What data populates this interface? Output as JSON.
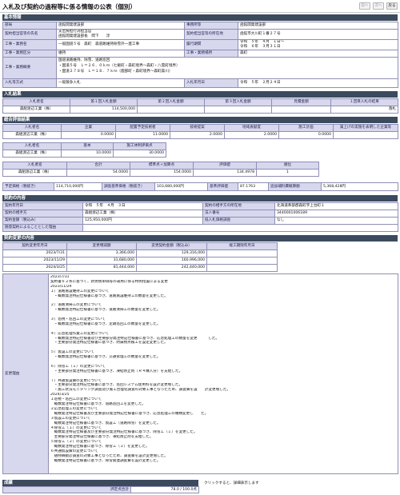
{
  "header": {
    "title": "入札及び契約の過程等に係る情報の公表（個別）",
    "nav": [
      "前へ",
      "次へ",
      "戻る"
    ]
  },
  "sections": {
    "basic": "基本情報",
    "bid": "入札結果",
    "eval": "総合評価結果",
    "contract": "契約の内容",
    "changes": "契約変更の内容",
    "grade": "成績"
  },
  "basic": {
    "rows": [
      [
        "部局",
        "函館開発建設部",
        "事務所等",
        "函館開発建設部"
      ],
      [
        "契約担当官等の氏名",
        "支出負担行為担当官\n函館開発建設部長　岡下　　淳",
        "契約担当官等の所在地",
        "函館市大川町１番２７号"
      ],
      [
        "工事・業務名",
        "一般国道５号　森町　森道路維持除雪外一連工事",
        "履行期間",
        "令和　５年　４月　１日～\n令和　６年　３月３１日"
      ],
      [
        "工事・業務区分",
        "維持",
        "工事・業務場所",
        "森町"
      ],
      [
        "工事・業務概要",
        "国道道路維持、除雪、道路巡回\n・国道５号　Ｌ＝２６．０ｋｍ（七飯町・森町境界～森町・八雲町境界）\n・国道２７８号　Ｌ＝１８．７ｋｍ（鹿部町・森町境界～森町森川）",
        "",
        ""
      ],
      [
        "入札等方式",
        "一般競争入札",
        "入札年月日",
        "令和　５年　２月２４日"
      ]
    ]
  },
  "bid": {
    "headers": [
      "入札者名",
      "第１回入札金額",
      "第２回入札金額",
      "第３回入札金額",
      "見積金額",
      "１回目入札の結果"
    ],
    "row": [
      "森組渡辺工業（株）",
      "114,500,000",
      "",
      "",
      "",
      "落札"
    ]
  },
  "eval": {
    "t1_headers": [
      "入札者名",
      "企業",
      "配置予定技術者",
      "技術提案",
      "地域貢献度",
      "施工計画",
      "賃上げの実施を表明した企業等"
    ],
    "t1_row": [
      "森組渡辺工業（株）",
      "0.0000",
      "11.0000",
      "2.0000",
      "2.0000",
      "0.0000",
      ""
    ],
    "t2_headers": [
      "入札者名",
      "基本",
      "施工体制評価点"
    ],
    "t2_row": [
      "森組渡辺工業（株）",
      "10.0000",
      "30.0000"
    ],
    "t3_headers": [
      "入札者名",
      "合計",
      "標準点＋加算点",
      "評価値",
      "順位"
    ],
    "t3_row": [
      "森組渡辺工業（株）",
      "54.0000",
      "154.0000",
      "134.4978",
      "1"
    ],
    "t4": [
      [
        "予定価格（税抜き）",
        "114,710,000円"
      ],
      [
        "調査基準価格（税抜き）",
        "103,680,000円"
      ],
      [
        "基準評価値",
        "87.1763"
      ],
      [
        "追加補料費概算額",
        "5,368,428円"
      ]
    ]
  },
  "contract": {
    "rows": [
      [
        "契約年月日",
        "令和　５年　４月　３日",
        "契約の相手方の所在地",
        "北海道茅部郡森町字上台町１"
      ],
      [
        "契約の相手方",
        "森組渡辺工業（株）",
        "法人番号",
        "3440001006189"
      ],
      [
        "契約金額（税込み）",
        "125,950,000円",
        "低入札価格調査",
        "なし"
      ],
      [
        "随意契約によることとした理由",
        "",
        "",
        ""
      ]
    ]
  },
  "changes": {
    "headers": [
      "契約変更年月日",
      "変更増減額",
      "変更契約金額（税込み）",
      "竣工期限年月日"
    ],
    "rows": [
      [
        "2023/7/31",
        "3,366,000",
        "129,316,000",
        ""
      ],
      [
        "2023/11/29",
        "31,680,000",
        "160,996,000",
        ""
      ],
      [
        "2024/3/25",
        "81,444,000",
        "242,440,000",
        ""
      ]
    ],
    "reason_label": "変更理由",
    "reason_lines": [
      "2023/7/31",
      "契約書６２条に基づく、新労務単価等の運用に係る特例措置による変更",
      "2023/11/29",
      "１）道路施設維持工の変更について",
      "　・概数発注特記仕様書に基づき、道路施設維持工の数量を変更した。",
      "",
      "２）道路清掃工の変更について",
      "　・概数発注特記仕様書に基づき、道路清掃工の数量を変更した。",
      "",
      "３）巡視・巡回工の変更について",
      "　・概数発注特記仕様書に基づき、定期巡回工の数量を変更した。",
      "",
      "４）応急処理作業工の変更について",
      "　・概数発注特記仕様書及び主要部分発注特記仕様書に基づき、応急処理工の数量を変更　　　した。",
      "　・主要部分発注特記仕様書に基づき、附属物点検工を設定変更した。",
      "",
      "５）仮設工の変更について",
      "　・概数発注特記仕様書に基づき、交通管理工の数量を変更した。",
      "",
      "６）除雪工（１）の変更について",
      "　・主要部分発注特記仕様書に基づき、凍結防止剤（Ｒ４購入分）を支給した。",
      "",
      "７）共通仮設費の変更について",
      "　・主要部分発注特記仕様書に基づき、巡回システム使用料を設計変更増した。",
      "　・施工状況モニタリング調査及び施工合理化調査の対象工事となったため、調査費を設　　計変更増した。",
      "2024/3/25",
      "１巡視・巡回工の変更について",
      "　概数発注特記仕様書に基づき、道路巡回工を変更した。",
      "２応急処理工の変更について",
      "　概数発注特記仕様書及び主要部分発注特記仕様書に基づき、応急処理工の種類変更し　　た。",
      "３仮設工の変更について",
      "　概数発注特記仕様書に基づき、仮設工（道路除雪）を変更した。",
      "４除雪工（１）の変更について",
      "　概数発注特記仕様書及び主要部分発注特記仕様書に基づき、除雪工（１）を変更した。",
      "　主要部分発注特記仕様書に基づき、凍結防止剤を支給した。",
      "５除雪工（２）の変更について",
      "　概数発注特記仕様書に基づき、除雪工（２）を変更した。",
      "６共通仮設費の変更について",
      "　随時舞動診調査の対象工事となったため、調査費を設計変更増した。",
      "　概数発注特記仕様書に基づき、除雪関連調査費を設計変更した。"
    ]
  },
  "grade": {
    "note": "クリックすると、詳細表示します",
    "label": "評定点合計",
    "value": "78.0 / 100.0点"
  }
}
